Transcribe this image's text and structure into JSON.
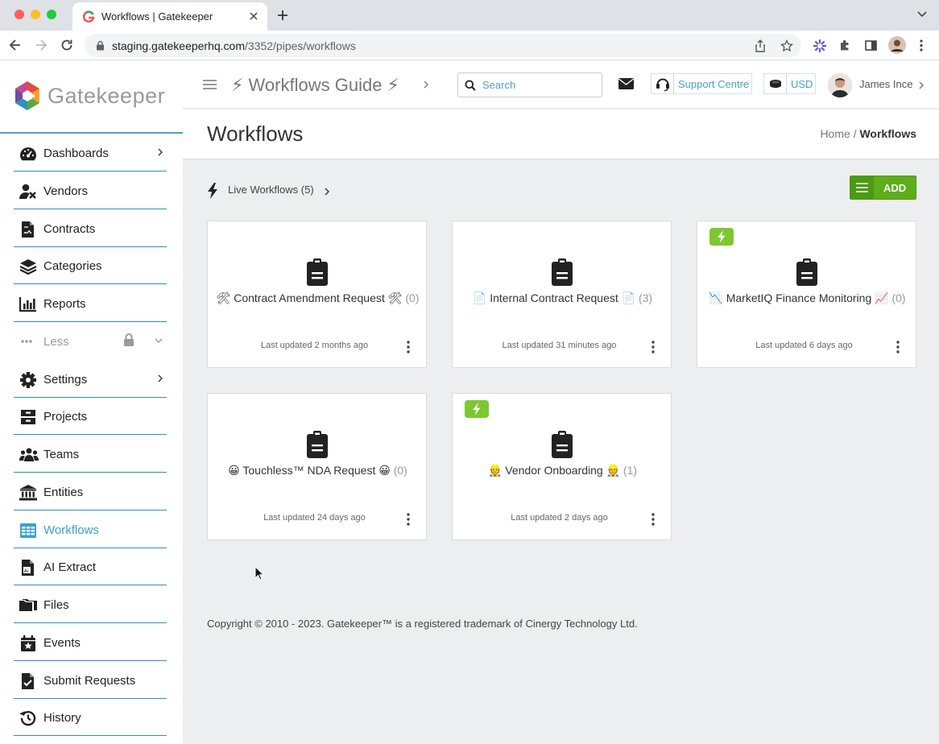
{
  "browser": {
    "tab_title": "Workflows | Gatekeeper",
    "url_host": "staging.gatekeeperhq.com",
    "url_path": "/3352/pipes/workflows"
  },
  "brand": {
    "name": "Gatekeeper"
  },
  "sidebar": {
    "items": [
      {
        "label": "Dashboards",
        "icon": "gauge-icon",
        "chevron": true
      },
      {
        "label": "Vendors",
        "icon": "vendors-icon"
      },
      {
        "label": "Contracts",
        "icon": "contract-icon"
      },
      {
        "label": "Categories",
        "icon": "layers-icon"
      },
      {
        "label": "Reports",
        "icon": "bar-chart-icon"
      },
      {
        "label": "Less",
        "icon": "ellipsis-icon"
      },
      {
        "label": "Settings",
        "icon": "gear-icon",
        "chevron": true
      },
      {
        "label": "Projects",
        "icon": "archive-icon"
      },
      {
        "label": "Teams",
        "icon": "teams-icon"
      },
      {
        "label": "Entities",
        "icon": "bank-icon"
      },
      {
        "label": "Workflows",
        "icon": "table-icon",
        "active": true
      },
      {
        "label": "AI Extract",
        "icon": "ai-file-icon"
      },
      {
        "label": "Files",
        "icon": "folders-icon"
      },
      {
        "label": "Events",
        "icon": "calendar-star-icon"
      },
      {
        "label": "Submit Requests",
        "icon": "file-check-icon"
      },
      {
        "label": "History",
        "icon": "history-icon"
      }
    ]
  },
  "topbar": {
    "guide_label": "⚡ Workflows Guide ⚡",
    "search_placeholder": "Search",
    "support_label": "Support Centre",
    "currency_label": "USD",
    "user_name": "James Ince"
  },
  "page": {
    "title": "Workflows",
    "breadcrumb_home": "Home",
    "breadcrumb_sep": "/",
    "breadcrumb_current": "Workflows",
    "live_label": "Live Workflows (5)",
    "add_label": "ADD",
    "copyright": "Copyright © 2010 - 2023. Gatekeeper™ is a registered trademark of Cinergy Technology Ltd."
  },
  "workflows": [
    {
      "title": "🛠 Contract Amendment Request 🛠",
      "count": "(0)",
      "updated": "Last updated 2 months ago",
      "live": false
    },
    {
      "title": "📄 Internal Contract Request 📄",
      "count": "(3)",
      "updated": "Last updated 31 minutes ago",
      "live": false
    },
    {
      "title": "📉 MarketIQ Finance Monitoring 📈",
      "count": "(0)",
      "updated": "Last updated 6 days ago",
      "live": true
    },
    {
      "title": "😀 Touchless™ NDA Request 😀",
      "count": "(0)",
      "updated": "Last updated 24 days ago",
      "live": false
    },
    {
      "title": "👷 Vendor Onboarding 👷",
      "count": "(1)",
      "updated": "Last updated 2 days ago",
      "live": true
    }
  ],
  "colors": {
    "accent": "#3aa0cc",
    "add_green": "#5cae1a",
    "live_badge": "#7cc82e"
  }
}
